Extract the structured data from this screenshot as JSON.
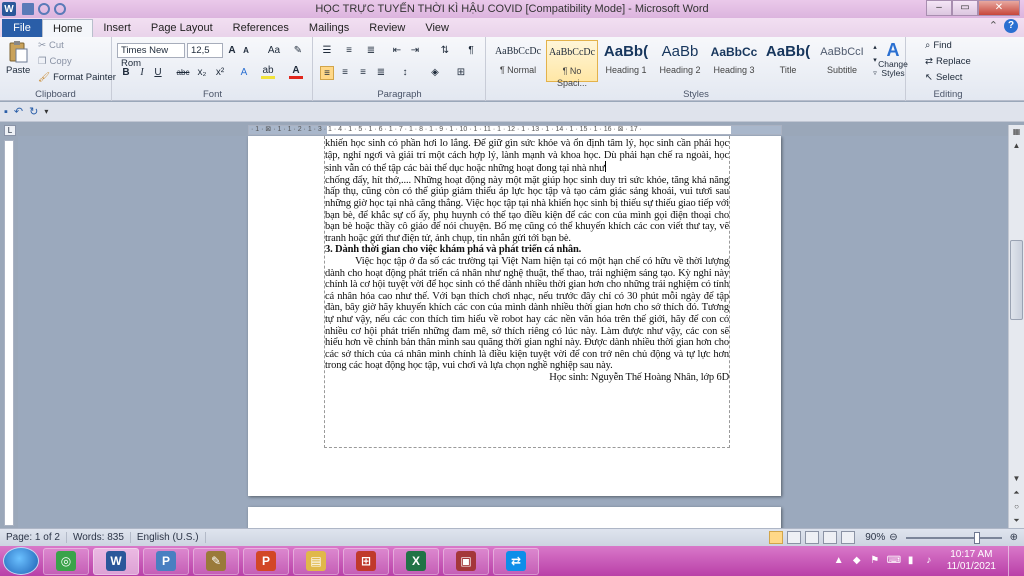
{
  "window": {
    "title": "HỌC TRỰC TUYẾN THỜI KÌ HẬU COVID [Compatibility Mode]  -  Microsoft Word",
    "app_letter": "W",
    "minimize": "–",
    "maximize": "▭",
    "close": "✕"
  },
  "tabs": {
    "file": "File",
    "items": [
      "Home",
      "Insert",
      "Page Layout",
      "References",
      "Mailings",
      "Review",
      "View"
    ],
    "active": "Home"
  },
  "ribbon": {
    "clipboard": {
      "label": "Clipboard",
      "paste": "Paste",
      "cut": "Cut",
      "copy": "Copy",
      "format_painter": "Format Painter"
    },
    "font": {
      "label": "Font",
      "font_name": "Times New Rom",
      "font_size": "12,5",
      "bold": "B",
      "italic": "I",
      "underline": "U",
      "strike": "abc",
      "subscript": "x₂",
      "superscript": "x²",
      "grow": "A",
      "shrink": "A",
      "case": "Aa"
    },
    "paragraph": {
      "label": "Paragraph"
    },
    "styles": {
      "label": "Styles",
      "items": [
        {
          "sample": "AaBbCcDc",
          "name": "¶ Normal"
        },
        {
          "sample": "AaBbCcDc",
          "name": "¶ No Spaci..."
        },
        {
          "sample": "AaBb(",
          "name": "Heading 1"
        },
        {
          "sample": "AaBb",
          "name": "Heading 2"
        },
        {
          "sample": "AaBbCc",
          "name": "Heading 3"
        },
        {
          "sample": "AaBb(",
          "name": "Title"
        },
        {
          "sample": "AaBbCcI",
          "name": "Subtitle"
        }
      ],
      "change_styles": "Change Styles"
    },
    "editing": {
      "label": "Editing",
      "find": "Find",
      "replace": "Replace",
      "select": "Select"
    }
  },
  "document": {
    "paragraphs": [
      {
        "kind": "body",
        "text": "khiến học sinh có phần hơi lo lắng. Để giữ gìn sức khỏe và ổn định tâm lý, học sinh cần phải học tập, nghỉ ngơi và giải trí một cách hợp lý, lành mạnh và khoa học. Dù phải hạn chế ra ngoài, học sinh vẫn có thể tập các bài thể dục hoặc những hoạt đong tại nhà như"
      },
      {
        "kind": "body",
        "text": "chống đẩy, hít thở,.... Những hoạt động này một mặt giúp học sinh duy trì sức khỏe, tăng khả năng hấp thụ, cũng còn có thể giúp giảm thiểu áp lực học tập và tạo cảm giác sảng khoái, vui tươi sau những giờ học tại nhà căng thẳng. Việc học tập tại nhà khiến học sinh bị thiếu sự thiếu giao tiếp với bạn bè, để khắc sự cố ấy, phụ huynh có thể tạo điều kiện để các con của mình gọi điện thoại cho bạn bè hoặc thầy cô giáo để nói chuyện. Bố mẹ cũng có thể khuyến khích các con viết thư tay, vẽ tranh hoặc gửi thư điện tử, ảnh chụp, tin nhắn gửi tới bạn bè."
      },
      {
        "kind": "heading",
        "text": "3. Dành thời gian cho việc khám phá và phát triển cá nhân."
      },
      {
        "kind": "indent",
        "text": "Việc học tập ở đa số các trường tại Việt Nam hiện tại có một hạn chế có hữu về thời lượng dành cho hoạt động phát triển cá nhân như nghệ thuật, thể thao, trải nghiệm sáng tạo. Kỳ nghỉ này chính là cơ hội tuyệt vời để học sinh có thể dành nhiều thời gian hơn cho những trải nghiệm có tính cá nhân hóa cao như thế. Với bạn thích chơi nhạc, nếu trước đây chỉ có 30 phút mỗi ngày để tập đàn, bây giờ hãy khuyến khích các con của mình dành nhiều thời gian hơn cho sở thích đó. Tương tự như vậy, nếu các con thích tìm hiểu về robot hay các nền văn hóa trên thế giới, hãy để con có nhiều cơ hội phát triển những đam mê, sở thích riêng có lúc này. Làm được như vậy, các con sẽ hiểu hơn về chính bản thân mình sau quãng thời gian nghỉ này. Được dành nhiều thời gian hơn cho các sở thích của cá nhân mình chính là điều kiện tuyệt vời để con trở nên chủ động và tự lực hơn trong các hoạt động học tập, vui chơi và lựa chọn nghề nghiệp sau này."
      },
      {
        "kind": "sig",
        "text": "Học sinh: Nguyễn Thế Hoàng Nhân, lớp 6D"
      }
    ]
  },
  "ruler": {
    "text": "· 1 · ⊠ · 1 · 1 · 2 · 1 · 3 · 1 · 4 · 1 · 5 · 1 · 6 · 1 · 7 · 1 · 8 · 1 · 9 · 1 · 10 · 1 · 11 · 1 · 12 · 1 · 13 · 1 · 14 · 1 · 15 · 1 · 16 · ⊠ · 17 ·"
  },
  "status": {
    "page": "Page: 1 of 2",
    "words": "Words: 835",
    "language": "English (U.S.)",
    "zoom": "90%"
  },
  "taskbar": {
    "apps": [
      {
        "name": "chrome",
        "glyph": "◎",
        "color": "#3aa34a"
      },
      {
        "name": "word",
        "glyph": "W",
        "color": "#2b579a",
        "active": true
      },
      {
        "name": "pdf",
        "glyph": "P",
        "color": "#4a7fc1"
      },
      {
        "name": "paint",
        "glyph": "✎",
        "color": "#9a7a3a"
      },
      {
        "name": "powerpoint",
        "glyph": "P",
        "color": "#d24726"
      },
      {
        "name": "explorer",
        "glyph": "▤",
        "color": "#e0b84a"
      },
      {
        "name": "network",
        "glyph": "⊞",
        "color": "#c0392b"
      },
      {
        "name": "excel",
        "glyph": "X",
        "color": "#217346"
      },
      {
        "name": "access",
        "glyph": "▣",
        "color": "#a4373a"
      },
      {
        "name": "teamviewer",
        "glyph": "⇄",
        "color": "#0e8ee9"
      }
    ],
    "time": "10:17 AM",
    "date": "11/01/2021"
  }
}
